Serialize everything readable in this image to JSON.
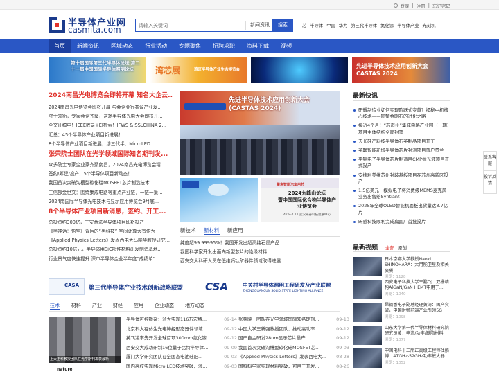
{
  "topbar": {
    "login": "登录",
    "sep1": "|",
    "register": "注册",
    "sep2": "|",
    "forgot": "忘记密码"
  },
  "logo": {
    "cn": "半导体产业网",
    "en": "casmita.com"
  },
  "search": {
    "placeholder": "请输入关键词",
    "scope": "新闻资讯",
    "button": "搜索"
  },
  "hotwords": [
    "芯",
    "半导体",
    "中国",
    "华为",
    "第三代半导体",
    "氮化镓",
    "半导体产业",
    "光刻机"
  ],
  "nav": [
    "首页",
    "新闻资讯",
    "区域动态",
    "行业活动",
    "专题聚焦",
    "招聘求职",
    "资料下载",
    "视频"
  ],
  "banners": {
    "b1": "第十届国际第三代半导体论坛 第二十一届中国国际半导体照明论坛",
    "b2_title": "湾芯展",
    "b2_sub": "湾区半导体产业生态博览会",
    "b4": "先进半导体技术应用创新大会 CASTAS 2024"
  },
  "left_news": {
    "headline1": "2024南昌光电博览会即将开幕 知名大企云...",
    "lines1": [
      "2024南昌光电博览会即将开幕 与会企业行共议产业发...",
      "院士领衔，专家会企齐聚，这场半导体光电大会即将开...",
      "全文征稿中！IEEE收录+EI检索！IFWS & SSLCHINA 2...",
      "汇总：45个半导体产业项目新进展！",
      "8个半导体产业项目新进展，涉三代半、MicroLED"
    ],
    "headline2": "张荣院士团队在光学领域国际知名期刊发...",
    "lines2": [
      "众多院士专家企业家齐聚南昌，2024南昌光电博览会精...",
      "签约/筹建/投产，5个半导体项目新动态！",
      "我国首次突破沟槽型碳化硅MOSFET芯片制造技术",
      "工信部金世文：围绕集成电路等重点产业链，一链一策...",
      "2024南国际半导体光电技术与显示应用博览会9月底..."
    ],
    "headline3": "8个半导体产业项目新消息，签约、开工...",
    "lines3": [
      "总投资约300亿，三安意法半导体项目即将投产",
      "《黑神话：悟空》背后的“黑科技” 空间计算大有作为",
      "《Applied Physics Letters》发表西电大马晓华教授研究...",
      "总投资约10亿元，半导体用SiC部件材料研发制造基地...",
      "行业景气度快速提升 深市半导体企业半年度“成绩单”..."
    ]
  },
  "center": {
    "main_caption": "先进半导体技术应用创新大会 (CASTAS 2024)",
    "small1_title": "2024九峰山论坛",
    "small1_sub": "暨中国国际化合物半导体产业博览会",
    "small1_date": "4.08-4.11 武汉光谷科技会展中心",
    "small2_title": "聚焦智能汽车用芯"
  },
  "center_tabs": [
    "新技术",
    "新材料",
    "新应用"
  ],
  "center_list": [
    "纯度超99.99995%！我国开发出超高纯石墨产品",
    "我国科学家开发出面向新型芯片的绝缘材料",
    "西安交大科研人员在低维钙钛矿器件领域取得进展"
  ],
  "latest": {
    "title": "最新快讯",
    "items": [
      "研耀制造业如何实现阶跃式变革？揭秘中机核心技术——固整金刚石的进化之路",
      "接近4个月！“芯声州”集成电路产业园（一期）项目主体结构全面封顶",
      "天长硅产料技半导体石英制品项目开工",
      "英联智能新增半导体芯片封测项目落户贵兰",
      "平锦电子半导体芯片制造用CMP抛光液项目正式投产",
      "安捷利美维苏州封装基板项目在苏州高新区投产",
      "1.5亿美元！模拟电子将消费级MEMS麦克风业务出售给Syntiant",
      "2025年全球OLED智能机面板出货量达8.7亿片",
      "昕感科技顺利完成扁圆厂首批投片"
    ]
  },
  "video": {
    "title": "最新视频",
    "tabs": [
      "全部",
      "原创"
    ],
    "items": [
      {
        "text": "日本京都大学教授Naoki SHINOHARA：大用能卫星及相关资质",
        "views": "浏览：1128"
      },
      {
        "text": "西安电子科技大学王鹏飞：双栅结构AlGaN/GaN HEMT中用于...",
        "views": "浏览：1040"
      },
      {
        "text": "昂钢香电子副总经理黄涛：国产突破，中国射频前端产业引领5G",
        "views": "浏览：1098"
      },
      {
        "text": "山东大学第一代半导体材料研究院研究员黄：电流/功率/缺陷材料",
        "views": "浏览：1077"
      },
      {
        "text": "中国电科十三所正高级工程师杜鹏博：47GHz-52GHz功率放大器",
        "views": "浏览：1052"
      }
    ]
  },
  "float": {
    "contact": "联系客服",
    "feedback": "投诉反馈"
  },
  "union": {
    "casa": "CASA",
    "casa_title": "第三代半导体产业技术创新战略联盟",
    "csa": "CSA",
    "csa_title_cn": "中关村半导体照明工程研发及产业联盟",
    "csa_title_en": "ZHONGGUANCUN SOLID STATE LIGHTING ALLIANCE"
  },
  "bottom_tabs": [
    "技术",
    "材料",
    "产业",
    "财经",
    "应用",
    "企业动态",
    "地方动态"
  ],
  "bottom_img_caption": "上大王科教授团队在光学期刊发表最新",
  "bottom_nature": "nature",
  "bottom_list_mid": [
    {
      "t": "半导体可控掺杂：浙大实现116万宏特...",
      "d": "09-14"
    },
    {
      "t": "北京科大在仿生光电神经形态器件领域...",
      "d": "09-12"
    },
    {
      "t": "英飞凌率先开发全球首项300mm氮化镓...",
      "d": "09-12"
    },
    {
      "t": "西安交大成功研制16位量子比特半导体...",
      "d": "09-09"
    },
    {
      "t": "厦门大学研究团队在全固态电池硅阳...",
      "d": "09-03"
    },
    {
      "t": "国内高校实现Micro LED技术突破，涉...",
      "d": "09-03"
    }
  ],
  "bottom_list_right": [
    {
      "t": "张荣院士团队在光学领域国际知名期刊...",
      "d": "09-13"
    },
    {
      "t": "中国大学王新强教授团队：推动高功率...",
      "d": "09-12"
    },
    {
      "t": "国产自主研发28nm显示芯片量产",
      "d": "09-12"
    },
    {
      "t": "我国首次突破沟槽型碳化硅MOSFET芯...",
      "d": "09-03"
    },
    {
      "t": "《Applied Physics Letters》发表西电大...",
      "d": "08-28"
    },
    {
      "t": "国科科学家实现材料突破，可用于开发...",
      "d": "08-26"
    }
  ]
}
